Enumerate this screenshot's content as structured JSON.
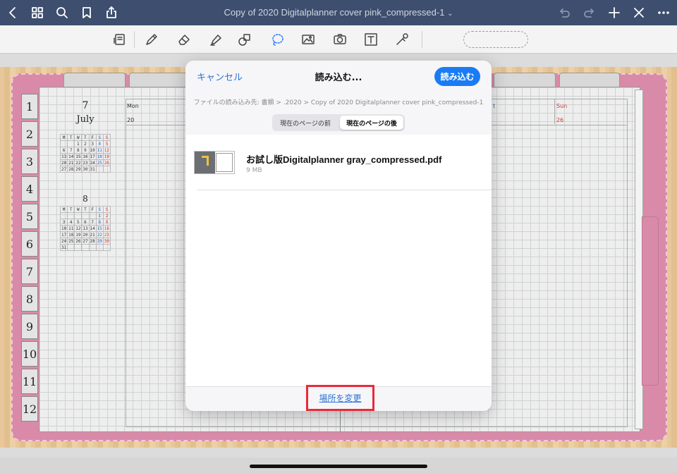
{
  "navbar": {
    "title": "Copy of 2020 Digitalplanner cover pink_compressed-1",
    "title_chevron": "⌄",
    "icons": [
      "back-icon",
      "grid-icon",
      "search-icon",
      "bookmark-icon",
      "share-icon",
      "undo-icon",
      "redo-icon",
      "add-icon",
      "close-icon",
      "more-icon"
    ]
  },
  "toolbar": {
    "tools": [
      "page-icon",
      "pen-icon",
      "eraser-icon",
      "highlighter-icon",
      "shapes-icon",
      "lasso-icon",
      "image-icon",
      "camera-icon",
      "text-icon",
      "laser-icon"
    ],
    "bluetooth": "✱"
  },
  "planner": {
    "side_tabs": [
      "1",
      "2",
      "3",
      "4",
      "5",
      "6",
      "7",
      "8",
      "9",
      "10",
      "11",
      "12"
    ],
    "july": {
      "number": "7",
      "name": "July",
      "weekdays": [
        "M",
        "T",
        "W",
        "T",
        "F",
        "S",
        "S"
      ],
      "rows": [
        [
          "",
          "",
          "1",
          "2",
          "3",
          "4",
          "5"
        ],
        [
          "6",
          "7",
          "8",
          "9",
          "10",
          "11",
          "12"
        ],
        [
          "13",
          "14",
          "15",
          "16",
          "17",
          "18",
          "19"
        ],
        [
          "20",
          "21",
          "22",
          "23",
          "24",
          "25",
          "26"
        ],
        [
          "27",
          "28",
          "29",
          "30",
          "31",
          "",
          ""
        ]
      ]
    },
    "august": {
      "number": "8",
      "weekdays": [
        "M",
        "T",
        "W",
        "T",
        "F",
        "S",
        "S"
      ],
      "rows": [
        [
          "",
          "",
          "",
          "",
          "",
          "1",
          "2"
        ],
        [
          "3",
          "4",
          "5",
          "6",
          "7",
          "8",
          "9"
        ],
        [
          "10",
          "11",
          "12",
          "13",
          "14",
          "15",
          "16"
        ],
        [
          "17",
          "18",
          "19",
          "20",
          "21",
          "22",
          "23"
        ],
        [
          "24",
          "25",
          "26",
          "27",
          "28",
          "29",
          "30"
        ],
        [
          "31",
          "",
          "",
          "",
          "",
          "",
          ""
        ]
      ]
    },
    "week": {
      "mon_label": "Mon",
      "mon_date": "20",
      "sat_label_partial": "t",
      "sun_label": "Sun",
      "sun_date": "26"
    }
  },
  "modal": {
    "cancel": "キャンセル",
    "title": "読み込む...",
    "import": "読み込む",
    "path": "ファイルの読み込み先: 書類 > .2020 > Copy of 2020 Digitalplanner cover pink_compressed-1",
    "segments": [
      "現在のページの前",
      "現在のページの後"
    ],
    "selected_segment": "現在のページの後",
    "file": {
      "name": "お試し版Digitalplanner gray_compressed.pdf",
      "size": "9 MB"
    },
    "change_location": "場所を変更",
    "accent_color": "#1a7cf4",
    "highlight_color": "#e82a3a"
  }
}
